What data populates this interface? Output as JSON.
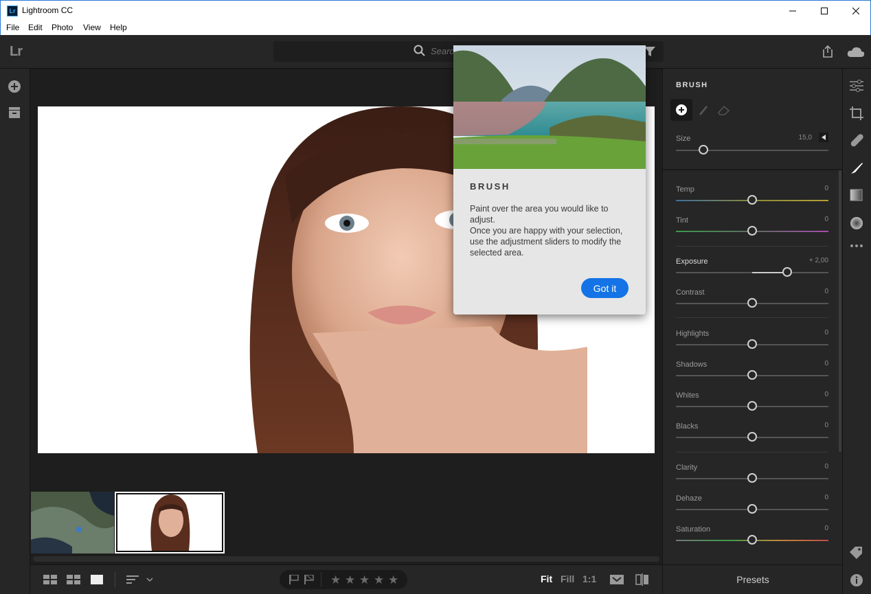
{
  "window": {
    "title": "Lightroom CC",
    "app_icon_text": "Lr"
  },
  "menu": [
    "File",
    "Edit",
    "Photo",
    "View",
    "Help"
  ],
  "appbar": {
    "logo": "Lr",
    "search_placeholder": "Search"
  },
  "panel": {
    "title": "BRUSH",
    "size": {
      "label": "Size",
      "value": "15,0",
      "position": 0.18
    },
    "sliders": [
      {
        "label": "Temp",
        "value": "0",
        "position": 0.5,
        "gradient": "temp"
      },
      {
        "label": "Tint",
        "value": "0",
        "position": 0.5,
        "gradient": "tint"
      },
      {
        "label": "Exposure",
        "value": "+ 2,00",
        "position": 0.73,
        "bright": true
      },
      {
        "label": "Contrast",
        "value": "0",
        "position": 0.5
      },
      {
        "label": "Highlights",
        "value": "0",
        "position": 0.5
      },
      {
        "label": "Shadows",
        "value": "0",
        "position": 0.5
      },
      {
        "label": "Whites",
        "value": "0",
        "position": 0.5
      },
      {
        "label": "Blacks",
        "value": "0",
        "position": 0.5
      },
      {
        "label": "Clarity",
        "value": "0",
        "position": 0.5
      },
      {
        "label": "Dehaze",
        "value": "0",
        "position": 0.5
      },
      {
        "label": "Saturation",
        "value": "0",
        "position": 0.5,
        "gradient": "sat"
      }
    ],
    "presets_label": "Presets"
  },
  "coach": {
    "title": "BRUSH",
    "body_line1": "Paint over the area you would like to adjust.",
    "body_line2": "Once you are happy with your selection, use the adjustment sliders to modify the selected area.",
    "button": "Got it"
  },
  "bottombar": {
    "zoom_fit": "Fit",
    "zoom_fill": "Fill",
    "zoom_1to1": "1:1",
    "rating_stars": 5
  },
  "colors": {
    "accent": "#1473e6",
    "panel_bg": "#262626",
    "canvas_bg": "#1e1e1e"
  }
}
